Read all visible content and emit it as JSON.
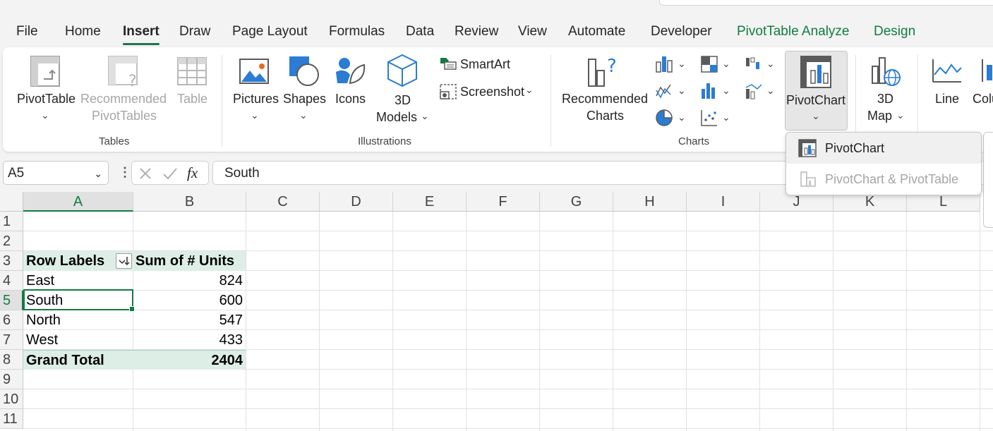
{
  "menu": {
    "tabs": [
      {
        "label": "File"
      },
      {
        "label": "Home"
      },
      {
        "label": "Insert"
      },
      {
        "label": "Draw"
      },
      {
        "label": "Page Layout"
      },
      {
        "label": "Formulas"
      },
      {
        "label": "Data"
      },
      {
        "label": "Review"
      },
      {
        "label": "View"
      },
      {
        "label": "Automate"
      },
      {
        "label": "Developer"
      },
      {
        "label": "PivotTable Analyze"
      },
      {
        "label": "Design"
      }
    ],
    "active": "Insert"
  },
  "ribbon": {
    "tables": {
      "pivottable": "PivotTable",
      "recommended_1": "Recommended",
      "recommended_2": "PivotTables",
      "table": "Table",
      "group": "Tables"
    },
    "illustrations": {
      "pictures": "Pictures",
      "shapes": "Shapes",
      "icons": "Icons",
      "models_1": "3D",
      "models_2": "Models",
      "smartart": "SmartArt",
      "screenshot": "Screenshot",
      "group": "Illustrations"
    },
    "charts": {
      "recommended_1": "Recommended",
      "recommended_2": "Charts",
      "pivotchart": "PivotChart",
      "group": "Charts"
    },
    "tours": {
      "map_1": "3D",
      "map_2": "Map"
    },
    "sparklines": {
      "line": "Line",
      "column": "Colu"
    }
  },
  "dropdown": {
    "items": [
      {
        "label": "PivotChart",
        "enabled": true
      },
      {
        "label": "PivotChart & PivotTable",
        "enabled": false
      }
    ]
  },
  "formula_bar": {
    "name_box": "A5",
    "value": "South",
    "fx": "fx"
  },
  "sheet": {
    "columns": [
      "A",
      "B",
      "C",
      "D",
      "E",
      "F",
      "G",
      "H",
      "I",
      "J",
      "K",
      "L"
    ],
    "rows": [
      "1",
      "2",
      "3",
      "4",
      "5",
      "6",
      "7",
      "8",
      "9",
      "10",
      "11"
    ],
    "pivot": {
      "header_labels": "Row Labels",
      "header_values": "Sum of # Units",
      "rows": [
        {
          "label": "East",
          "value": "824"
        },
        {
          "label": "South",
          "value": "600"
        },
        {
          "label": "North",
          "value": "547"
        },
        {
          "label": "West",
          "value": "433"
        }
      ],
      "total_label": "Grand Total",
      "total_value": "2404"
    },
    "selected_cell": "A5"
  },
  "colors": {
    "accent": "#107c41",
    "pivot_fill": "#ddeee6"
  }
}
